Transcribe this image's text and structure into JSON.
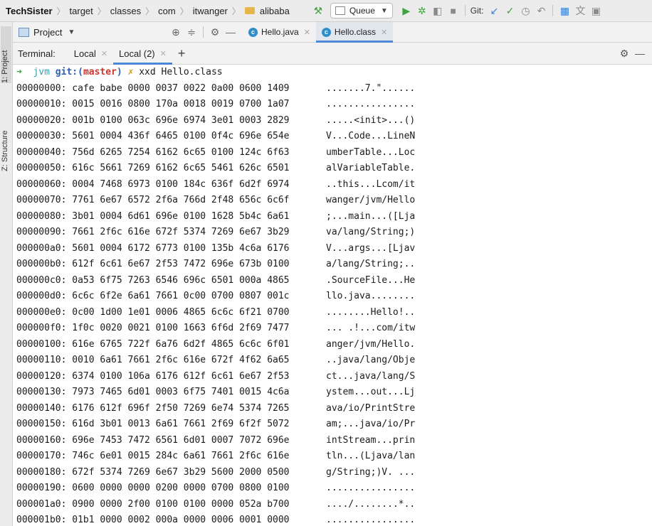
{
  "navbar": {
    "breadcrumbs": [
      "TechSister",
      "target",
      "classes",
      "com",
      "itwanger",
      "alibaba"
    ],
    "run_config": "Queue",
    "git_label": "Git:"
  },
  "left_strip": {
    "project_tab": "1: Project",
    "structure_tab": "Z: Structure"
  },
  "tabrow": {
    "project_selector": "Project",
    "editor_tabs": [
      {
        "label": "Hello.java",
        "active": false
      },
      {
        "label": "Hello.class",
        "active": true
      }
    ]
  },
  "terminal_bar": {
    "label": "Terminal:",
    "tabs": [
      {
        "label": "Local",
        "active": false
      },
      {
        "label": "Local (2)",
        "active": true
      }
    ]
  },
  "terminal": {
    "prompt": {
      "arrow": "➜",
      "dir": "jvm",
      "git": "git:(",
      "branch": "master",
      "git_close": ")",
      "dirty": "✗",
      "command": "xxd Hello.class"
    },
    "lines": [
      {
        "hex": "00000000: cafe babe 0000 0037 0022 0a00 0600 1409",
        "ascii": ".......7.\"......"
      },
      {
        "hex": "00000010: 0015 0016 0800 170a 0018 0019 0700 1a07",
        "ascii": "................"
      },
      {
        "hex": "00000020: 001b 0100 063c 696e 6974 3e01 0003 2829",
        "ascii": ".....<init>...()"
      },
      {
        "hex": "00000030: 5601 0004 436f 6465 0100 0f4c 696e 654e",
        "ascii": "V...Code...LineN"
      },
      {
        "hex": "00000040: 756d 6265 7254 6162 6c65 0100 124c 6f63",
        "ascii": "umberTable...Loc"
      },
      {
        "hex": "00000050: 616c 5661 7269 6162 6c65 5461 626c 6501",
        "ascii": "alVariableTable."
      },
      {
        "hex": "00000060: 0004 7468 6973 0100 184c 636f 6d2f 6974",
        "ascii": "..this...Lcom/it"
      },
      {
        "hex": "00000070: 7761 6e67 6572 2f6a 766d 2f48 656c 6c6f",
        "ascii": "wanger/jvm/Hello"
      },
      {
        "hex": "00000080: 3b01 0004 6d61 696e 0100 1628 5b4c 6a61",
        "ascii": ";...main...([Lja"
      },
      {
        "hex": "00000090: 7661 2f6c 616e 672f 5374 7269 6e67 3b29",
        "ascii": "va/lang/String;)"
      },
      {
        "hex": "000000a0: 5601 0004 6172 6773 0100 135b 4c6a 6176",
        "ascii": "V...args...[Ljav"
      },
      {
        "hex": "000000b0: 612f 6c61 6e67 2f53 7472 696e 673b 0100",
        "ascii": "a/lang/String;.."
      },
      {
        "hex": "000000c0: 0a53 6f75 7263 6546 696c 6501 000a 4865",
        "ascii": ".SourceFile...He"
      },
      {
        "hex": "000000d0: 6c6c 6f2e 6a61 7661 0c00 0700 0807 001c",
        "ascii": "llo.java........"
      },
      {
        "hex": "000000e0: 0c00 1d00 1e01 0006 4865 6c6c 6f21 0700",
        "ascii": "........Hello!.."
      },
      {
        "hex": "000000f0: 1f0c 0020 0021 0100 1663 6f6d 2f69 7477",
        "ascii": "... .!...com/itw"
      },
      {
        "hex": "00000100: 616e 6765 722f 6a76 6d2f 4865 6c6c 6f01",
        "ascii": "anger/jvm/Hello."
      },
      {
        "hex": "00000110: 0010 6a61 7661 2f6c 616e 672f 4f62 6a65",
        "ascii": "..java/lang/Obje"
      },
      {
        "hex": "00000120: 6374 0100 106a 6176 612f 6c61 6e67 2f53",
        "ascii": "ct...java/lang/S"
      },
      {
        "hex": "00000130: 7973 7465 6d01 0003 6f75 7401 0015 4c6a",
        "ascii": "ystem...out...Lj"
      },
      {
        "hex": "00000140: 6176 612f 696f 2f50 7269 6e74 5374 7265",
        "ascii": "ava/io/PrintStre"
      },
      {
        "hex": "00000150: 616d 3b01 0013 6a61 7661 2f69 6f2f 5072",
        "ascii": "am;...java/io/Pr"
      },
      {
        "hex": "00000160: 696e 7453 7472 6561 6d01 0007 7072 696e",
        "ascii": "intStream...prin"
      },
      {
        "hex": "00000170: 746c 6e01 0015 284c 6a61 7661 2f6c 616e",
        "ascii": "tln...(Ljava/lan"
      },
      {
        "hex": "00000180: 672f 5374 7269 6e67 3b29 5600 2000 0500",
        "ascii": "g/String;)V. ..."
      },
      {
        "hex": "00000190: 0600 0000 0000 0200 0000 0700 0800 0100",
        "ascii": "................"
      },
      {
        "hex": "000001a0: 0900 0000 2f00 0100 0100 0000 052a b700",
        "ascii": "..../........*.."
      },
      {
        "hex": "000001b0: 01b1 0000 0002 000a 0000 0006 0001 0000",
        "ascii": "................"
      }
    ]
  }
}
